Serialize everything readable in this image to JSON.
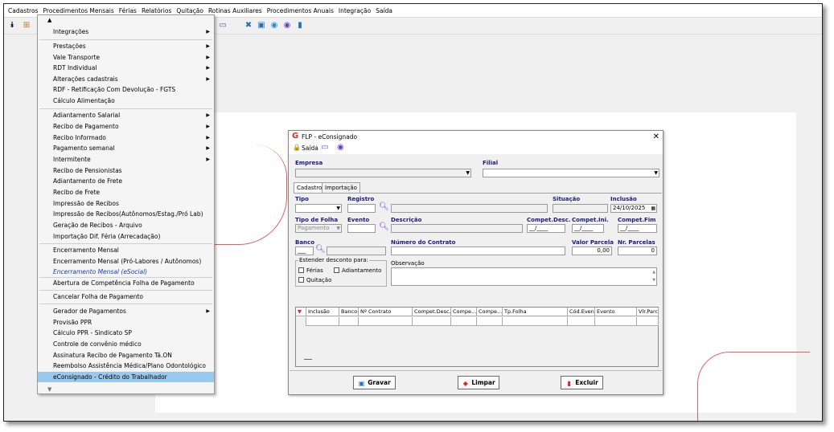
{
  "menu": [
    "Cadastros",
    "Procedimentos Mensais",
    "Férias",
    "Relatórios",
    "Quitação",
    "Rotinas Auxiliares",
    "Procedimentos Anuais",
    "Integração",
    "Saída"
  ],
  "dropdown": {
    "items": [
      {
        "label": "Integrações",
        "sub": "▶"
      },
      {
        "label": "Prestações",
        "sub": "▶"
      },
      {
        "label": "Vale Transporte",
        "sub": "▶"
      },
      {
        "label": "RDT Individual",
        "sub": "▶"
      },
      {
        "label": "Alterações cadastrais",
        "sub": "▶"
      },
      {
        "label": "RDF - Retificação Com Devolução - FGTS",
        "sub": ""
      },
      {
        "label": "Cálculo Alimentação",
        "sub": ""
      },
      {
        "label": "Adiantamento Salarial",
        "sub": "▶"
      },
      {
        "label": "Recibo de Pagamento",
        "sub": "▶"
      },
      {
        "label": "Recibo Informado",
        "sub": "▶"
      },
      {
        "label": "Pagamento semanal",
        "sub": "▶"
      },
      {
        "label": "Intermitente",
        "sub": "▶"
      },
      {
        "label": "Recibo de Pensionistas",
        "sub": ""
      },
      {
        "label": "Adiantamento de Frete",
        "sub": ""
      },
      {
        "label": "Recibo de Frete",
        "sub": ""
      },
      {
        "label": "Impressão de Recibos",
        "sub": ""
      },
      {
        "label": "Impressão de Recibos(Autônomos/Estag./Pró Lab)",
        "sub": ""
      },
      {
        "label": "Geração de Recibos - Arquivo",
        "sub": ""
      },
      {
        "label": "Importação Dif. Féria (Arrecadação)",
        "sub": ""
      },
      {
        "label": "Encerramento Mensal",
        "sub": ""
      },
      {
        "label": "Encerramento Mensal (Pró-Labores / Autônomos)",
        "sub": ""
      },
      {
        "label": "Encerramento Mensal (eSocial)",
        "sub": ""
      },
      {
        "label": "Abertura de Competência Folha de Pagamento",
        "sub": ""
      },
      {
        "label": "Cancelar Folha de Pagamento",
        "sub": ""
      },
      {
        "label": "Gerador de Pagamentos",
        "sub": "▶"
      },
      {
        "label": "Provisão PPR",
        "sub": ""
      },
      {
        "label": "Cálculo PPR - Sindicato SP",
        "sub": ""
      },
      {
        "label": "Controle de convênio médico",
        "sub": ""
      },
      {
        "label": "Assinatura Recibo de Pagamento Tá.ON",
        "sub": ""
      },
      {
        "label": "Reembolso Assistência Médica/Plano Odontológico",
        "sub": ""
      },
      {
        "label": "eConsignado - Crédito do Trabalhador",
        "sub": ""
      }
    ]
  },
  "dialog": {
    "title": "FLP - eConsignado",
    "tool_exit": "Saída",
    "labels": {
      "empresa": "Empresa",
      "filial": "Filial",
      "tipo": "Tipo",
      "registro": "Registro",
      "situacao": "Situação",
      "inclusao": "Inclusão",
      "tipo_folha": "Tipo de Folha",
      "evento": "Evento",
      "descricao": "Descrição",
      "compet_desc": "Compet.Desc.",
      "compet_ini": "Compet.Ini.",
      "compet_fim": "Compet.Fim",
      "banco": "Banco",
      "numero_contrato": "Número do Contrato",
      "valor_parcela": "Valor Parcela",
      "nr_parcelas": "Nr. Parcelas",
      "estender": "Estender desconto para:",
      "observacao": "Observação"
    },
    "tabs": [
      "Cadastro",
      "Importação"
    ],
    "values": {
      "inclusao": "24/10/2025",
      "tipo_folha": "Pagamento",
      "compet_desc": "__/____",
      "compet_ini": "__/____",
      "compet_fim": "__/____",
      "banco": "___",
      "valor_parcela": "0,00",
      "nr_parcelas": "0"
    },
    "checkboxes": {
      "ferias": "Férias",
      "adiantamento": "Adiantamento",
      "quitacao": "Quitação"
    },
    "grid_headers": [
      "Inclusão",
      "Banco",
      "Nº Contrato",
      "Compet.Desc.",
      "Compe...",
      "Compe...",
      "Tp.Folha",
      "Cód.Even...",
      "Evento",
      "Vlr.Parc."
    ],
    "buttons": {
      "gravar": "Gravar",
      "limpar": "Limpar",
      "excluir": "Excluir"
    },
    "colors": {
      "label": "#1a1a7a",
      "accent": "#6a3fc4",
      "danger": "#d62b2b"
    }
  }
}
